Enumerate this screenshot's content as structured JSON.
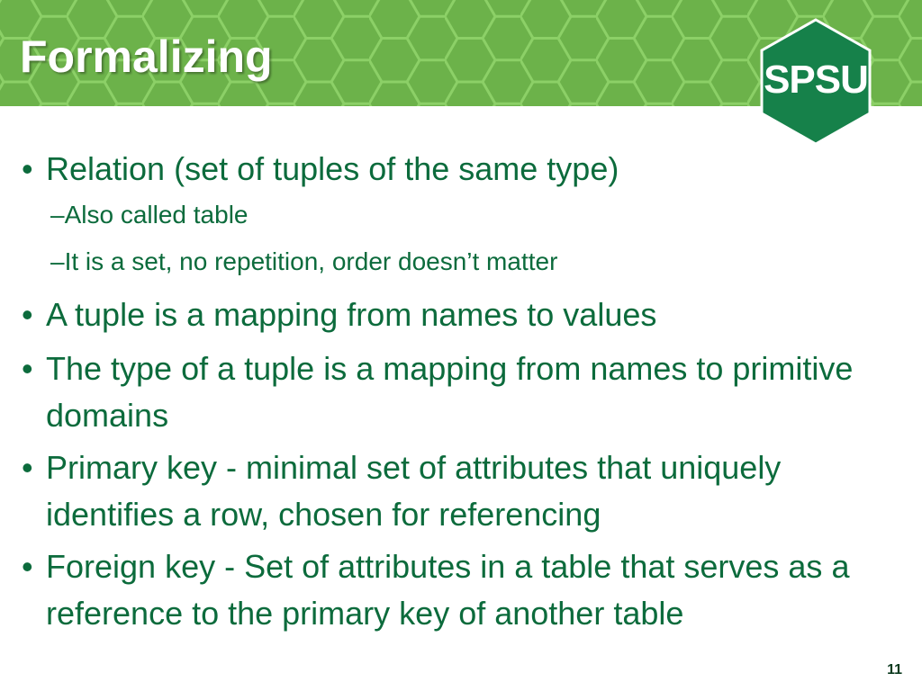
{
  "slide": {
    "title": "Formalizing",
    "logo_text": "SPSU",
    "page_number": "11",
    "bullet_glyph": "•",
    "sub_glyph": "–",
    "bullets": [
      {
        "text": "Relation (set of tuples of the same type)"
      },
      {
        "text": "Also called table"
      },
      {
        "text": "It is a set, no repetition, order doesn’t matter"
      },
      {
        "text": "A tuple is a mapping from names to values"
      },
      {
        "text": "The type of a tuple is a mapping from names to primitive domains"
      },
      {
        "text": "Primary key - minimal set of attributes that uniquely identifies a row, chosen for referencing"
      },
      {
        "text": "Foreign key - Set of attributes in a table that serves as a reference to the primary key of another table"
      }
    ]
  },
  "colors": {
    "header_green": "#6cb24a",
    "hex_line": "#8fd36a",
    "logo_green": "#16814a",
    "text_green": "#0c6b3c"
  }
}
